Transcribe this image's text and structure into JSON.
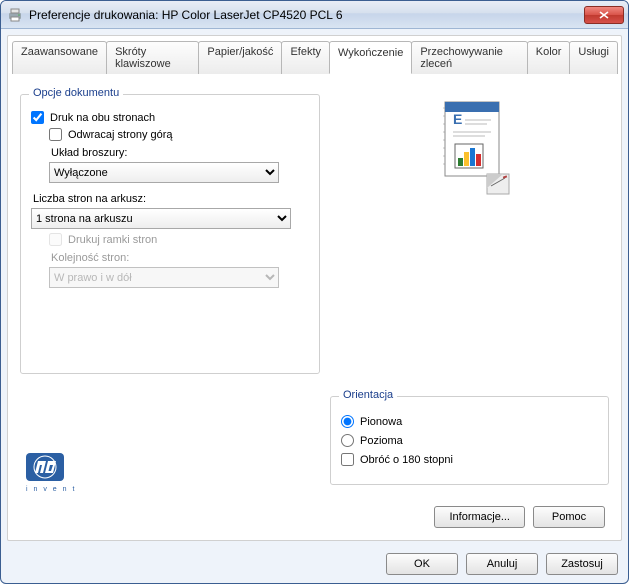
{
  "window": {
    "title": "Preferencje drukowania: HP Color LaserJet CP4520 PCL 6"
  },
  "tabs": {
    "items": [
      {
        "label": "Zaawansowane"
      },
      {
        "label": "Skróty klawiszowe"
      },
      {
        "label": "Papier/jakość"
      },
      {
        "label": "Efekty"
      },
      {
        "label": "Wykończenie"
      },
      {
        "label": "Przechowywanie zleceń"
      },
      {
        "label": "Kolor"
      },
      {
        "label": "Usługi"
      }
    ],
    "active_index": 4
  },
  "doc_options": {
    "legend": "Opcje dokumentu",
    "print_both_sides": {
      "label": "Druk na obu stronach",
      "checked": true
    },
    "flip_pages_up": {
      "label": "Odwracaj strony górą",
      "checked": false
    },
    "booklet_layout_label": "Układ broszury:",
    "booklet_layout_value": "Wyłączone",
    "pages_per_sheet_label": "Liczba stron na arkusz:",
    "pages_per_sheet_value": "1 strona na arkuszu",
    "print_page_borders": {
      "label": "Drukuj ramki stron",
      "checked": false,
      "disabled": true
    },
    "page_order_label": "Kolejność stron:",
    "page_order_value": "W prawo i w dół",
    "page_order_disabled": true
  },
  "orientation": {
    "legend": "Orientacja",
    "portrait": {
      "label": "Pionowa",
      "checked": true
    },
    "landscape": {
      "label": "Pozioma",
      "checked": false
    },
    "rotate180": {
      "label": "Obróć o 180 stopni",
      "checked": false
    }
  },
  "inner_buttons": {
    "info": "Informacje...",
    "help": "Pomoc"
  },
  "dialog_buttons": {
    "ok": "OK",
    "cancel": "Anuluj",
    "apply": "Zastosuj"
  },
  "logo": {
    "brand": "hp",
    "tagline": "invent"
  }
}
